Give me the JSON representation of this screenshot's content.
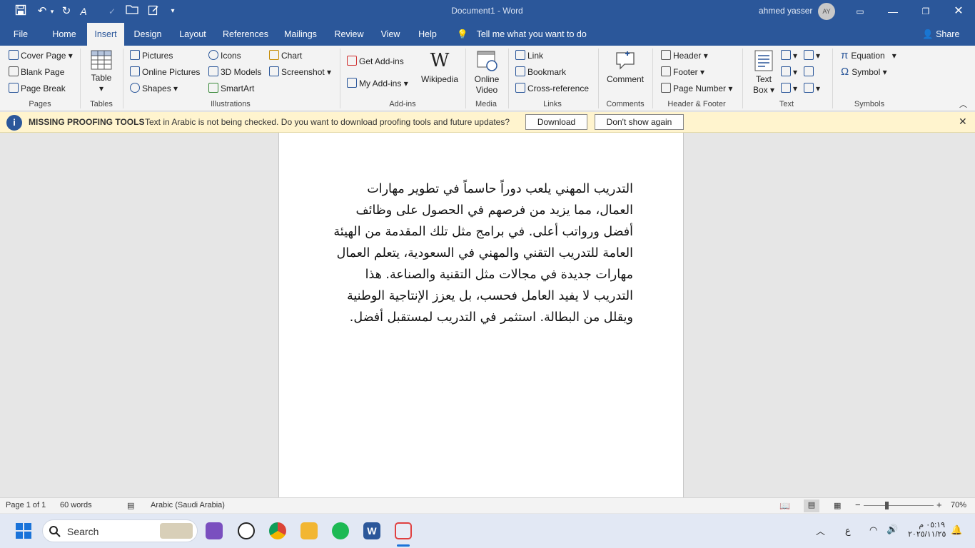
{
  "window": {
    "doc_title": "Document1 - Word",
    "user_name": "ahmed yasser",
    "user_initials": "AY"
  },
  "tabs": [
    "File",
    "Home",
    "Insert",
    "Design",
    "Layout",
    "References",
    "Mailings",
    "Review",
    "View",
    "Help"
  ],
  "tell_me": "Tell me what you want to do",
  "share": "Share",
  "ribbon": {
    "pages": {
      "cover": "Cover Page",
      "blank": "Blank Page",
      "break": "Page Break",
      "group": "Pages"
    },
    "tables": {
      "table": "Table",
      "group": "Tables"
    },
    "illustrations": {
      "pictures": "Pictures",
      "online_pictures": "Online Pictures",
      "shapes": "Shapes",
      "icons": "Icons",
      "models": "3D Models",
      "smartart": "SmartArt",
      "chart": "Chart",
      "screenshot": "Screenshot",
      "group": "Illustrations"
    },
    "addins": {
      "get": "Get Add-ins",
      "my": "My Add-ins",
      "wikipedia": "Wikipedia",
      "group": "Add-ins"
    },
    "media": {
      "online_video_1": "Online",
      "online_video_2": "Video",
      "group": "Media"
    },
    "links": {
      "link": "Link",
      "bookmark": "Bookmark",
      "cross": "Cross-reference",
      "group": "Links"
    },
    "comments": {
      "comment": "Comment",
      "group": "Comments"
    },
    "header_footer": {
      "header": "Header",
      "footer": "Footer",
      "page_number": "Page Number",
      "group": "Header & Footer"
    },
    "text": {
      "textbox_1": "Text",
      "textbox_2": "Box",
      "group": "Text"
    },
    "symbols": {
      "equation": "Equation",
      "symbol": "Symbol",
      "group": "Symbols"
    }
  },
  "message_bar": {
    "title": "MISSING PROOFING TOOLS",
    "text": "Text in Arabic is not being checked. Do you want to download proofing tools and future updates?",
    "download": "Download",
    "dont_show": "Don't show again"
  },
  "document": {
    "paragraph": "التدريب المهني يلعب دوراً حاسماً في تطوير مهارات العمال، مما يزيد من فرصهم في الحصول على وظائف أفضل ورواتب أعلى. في برامج مثل تلك المقدمة من الهيئة العامة للتدريب التقني والمهني في السعودية، يتعلم العمال مهارات جديدة في مجالات مثل التقنية والصناعة. هذا التدريب لا يفيد العامل فحسب، بل يعزز الإنتاجية الوطنية ويقلل من البطالة. استثمر في التدريب لمستقبل أفضل."
  },
  "status": {
    "page": "Page 1 of 1",
    "words": "60 words",
    "language": "Arabic (Saudi Arabia)",
    "zoom": "70%"
  },
  "taskbar": {
    "search": "Search",
    "time": "٠٥:١٩ م",
    "date": "٢٠٢٥/١١/٢٥",
    "ime": "ع"
  }
}
